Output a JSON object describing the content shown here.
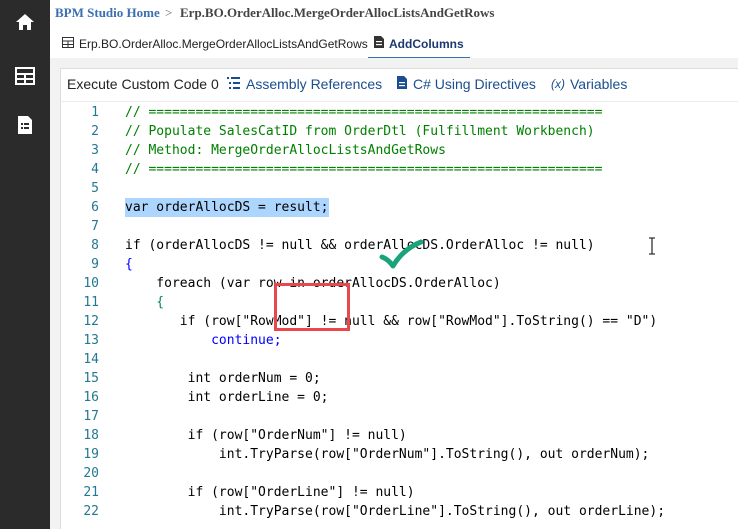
{
  "nav": {
    "icons": [
      "home-icon",
      "grid-icon",
      "document-icon"
    ]
  },
  "breadcrumb": {
    "home": "BPM Studio Home",
    "separator": ">",
    "path": "Erp.BO.OrderAlloc.MergeOrderAllocListsAndGetRows"
  },
  "tabs": [
    {
      "label": "Erp.BO.OrderAlloc.MergeOrderAllocListsAndGetRows",
      "icon": "table-icon"
    },
    {
      "label": "AddColumns",
      "icon": "code-file-icon"
    }
  ],
  "toolbar": {
    "title": "Execute Custom Code 0",
    "assembly_refs": "Assembly References",
    "using_directives": "C# Using Directives",
    "variables_prefix": "(x)",
    "variables": "Variables"
  },
  "code": {
    "line_numbers": [
      "1",
      "2",
      "3",
      "4",
      "5",
      "6",
      "7",
      "8",
      "9",
      "10",
      "11",
      "12",
      "13",
      "14",
      "15",
      "16",
      "17",
      "18",
      "19",
      "20",
      "21",
      "22"
    ],
    "lines": [
      "// ==========================================================",
      "// Populate SalesCatID from OrderDtl (Fulfillment Workbench)",
      "// Method: MergeOrderAllocListsAndGetRows",
      "// ==========================================================",
      "",
      "var orderAllocDS = result;",
      "",
      "if (orderAllocDS != null && orderAllocDS.OrderAlloc != null)",
      "{",
      "    foreach (var row in orderAllocDS.OrderAlloc)",
      "    {",
      "       if (row[\"RowMod\"] != null && row[\"RowMod\"].ToString() == \"D\")",
      "           continue;",
      "",
      "        int orderNum = 0;",
      "        int orderLine = 0;",
      "",
      "        if (row[\"OrderNum\"] != null)",
      "            int.TryParse(row[\"OrderNum\"].ToString(), out orderNum);",
      "",
      "        if (row[\"OrderLine\"] != null)",
      "            int.TryParse(row[\"OrderLine\"].ToString(), out orderLine);"
    ]
  },
  "colors": {
    "rail": "#2b2b2b",
    "accent": "#3a6fb0",
    "annotation_box": "#e8474b",
    "annotation_check": "#1aa37a"
  }
}
